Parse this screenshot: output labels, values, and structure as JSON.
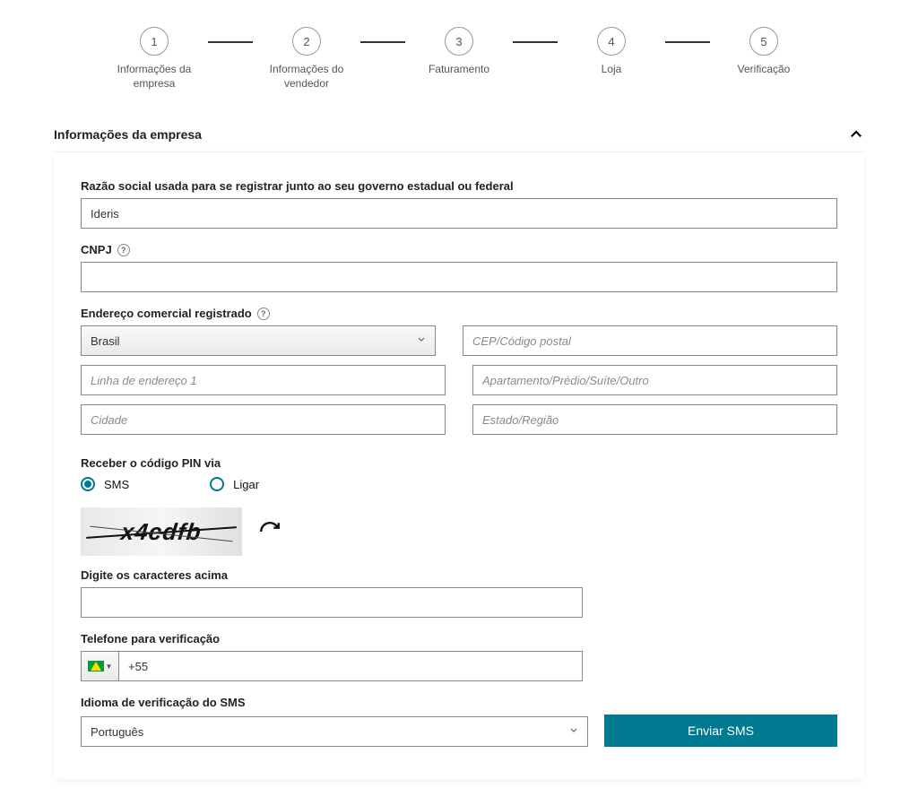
{
  "steps": [
    {
      "num": "1",
      "label": "Informações da empresa"
    },
    {
      "num": "2",
      "label": "Informações do vendedor"
    },
    {
      "num": "3",
      "label": "Faturamento"
    },
    {
      "num": "4",
      "label": "Loja"
    },
    {
      "num": "5",
      "label": "Verificação"
    }
  ],
  "section_title": "Informações da empresa",
  "fields": {
    "razao_label": "Razão social usada para se registrar junto ao seu governo estadual ou federal",
    "razao_value": "Ideris",
    "cnpj_label": "CNPJ",
    "cnpj_value": "",
    "endereco_label": "Endereço comercial registrado",
    "country_value": "Brasil",
    "cep_placeholder": "CEP/Código postal",
    "linha1_placeholder": "Linha de endereço 1",
    "apt_placeholder": "Apartamento/Prédio/Suíte/Outro",
    "cidade_placeholder": "Cidade",
    "estado_placeholder": "Estado/Região"
  },
  "pin": {
    "label": "Receber o código PIN via",
    "opt_sms": "SMS",
    "opt_ligar": "Ligar"
  },
  "captcha": {
    "text": "x4cdfb",
    "input_label": "Digite os caracteres acima"
  },
  "phone": {
    "label": "Telefone para verificação",
    "value": "+55"
  },
  "lang": {
    "label": "Idioma de verificação do SMS",
    "value": "Português"
  },
  "send_btn": "Enviar SMS",
  "help_glyph": "?"
}
